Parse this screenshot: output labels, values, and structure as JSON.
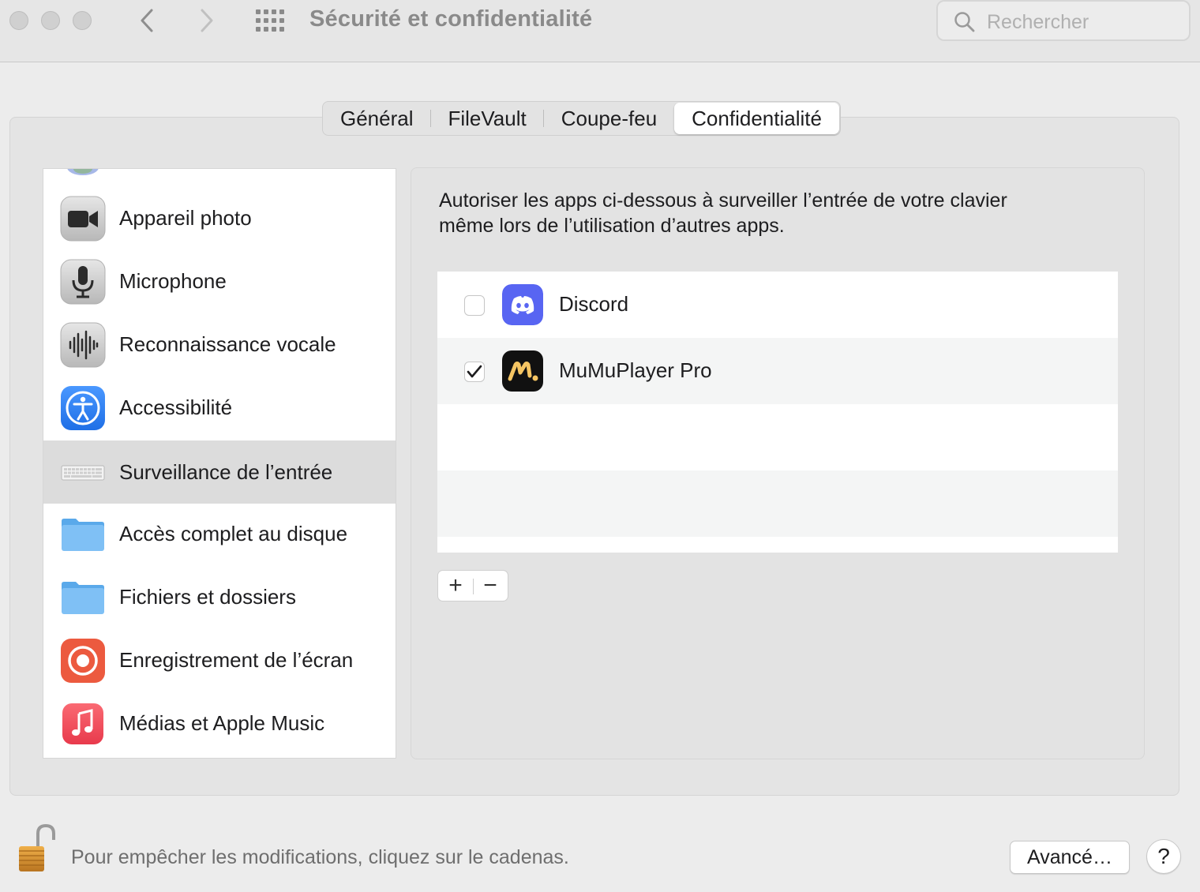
{
  "window": {
    "title": "Sécurité et confidentialité",
    "search_placeholder": "Rechercher"
  },
  "tabs": [
    {
      "label": "Général"
    },
    {
      "label": "FileVault"
    },
    {
      "label": "Coupe-feu"
    },
    {
      "label": "Confidentialité",
      "active": true
    }
  ],
  "sidebar": {
    "items": [
      {
        "label": "Appareil photo",
        "icon": "camera-icon"
      },
      {
        "label": "Microphone",
        "icon": "microphone-icon"
      },
      {
        "label": "Reconnaissance vocale",
        "icon": "waveform-icon"
      },
      {
        "label": "Accessibilité",
        "icon": "accessibility-icon"
      },
      {
        "label": "Surveillance de l’entrée",
        "icon": "keyboard-icon",
        "selected": true
      },
      {
        "label": "Accès complet au disque",
        "icon": "folder-icon"
      },
      {
        "label": "Fichiers et dossiers",
        "icon": "folder-icon"
      },
      {
        "label": "Enregistrement de l’écran",
        "icon": "screen-record-icon"
      },
      {
        "label": "Médias et Apple Music",
        "icon": "music-icon"
      }
    ]
  },
  "panel": {
    "description_line1": "Autoriser les apps ci-dessous à surveiller l’entrée de votre clavier",
    "description_line2": "même lors de l’utilisation d’autres apps.",
    "apps": [
      {
        "name": "Discord",
        "checked": false,
        "icon": "discord-icon"
      },
      {
        "name": "MuMuPlayer Pro",
        "checked": true,
        "icon": "mumuplayer-icon"
      }
    ],
    "add_label": "+",
    "remove_label": "−"
  },
  "footer": {
    "lock_text": "Pour empêcher les modifications, cliquez sur le cadenas.",
    "advanced_label": "Avancé…",
    "help_label": "?"
  },
  "colors": {
    "accent_blue": "#2d7cf6",
    "discord": "#5865f2",
    "screen_record": "#ec5a3f",
    "music": "#f04a5a",
    "folder": "#6fb7f2"
  }
}
